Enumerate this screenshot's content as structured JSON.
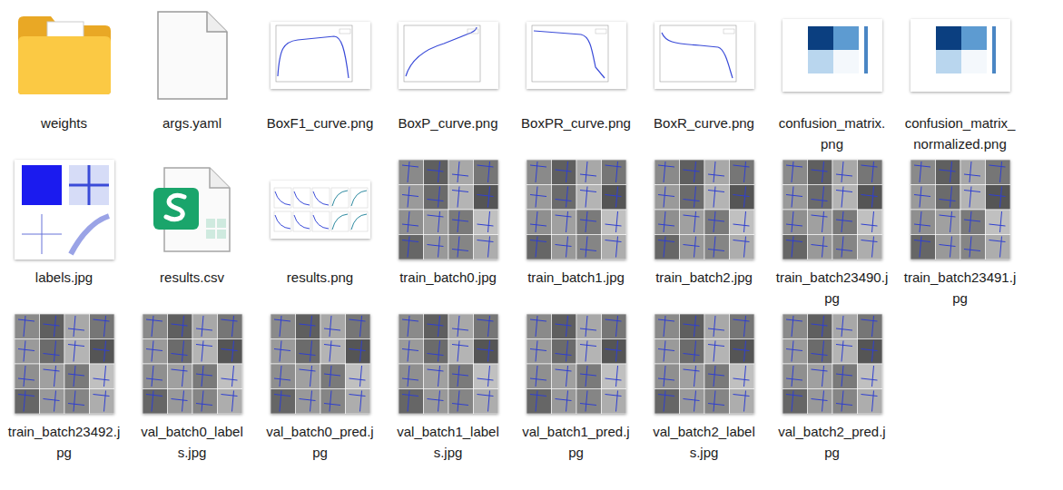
{
  "items": [
    {
      "name": "weights",
      "kind": "folder"
    },
    {
      "name": "args.yaml",
      "kind": "file"
    },
    {
      "name": "BoxF1_curve.png",
      "kind": "curve"
    },
    {
      "name": "BoxP_curve.png",
      "kind": "curve"
    },
    {
      "name": "BoxPR_curve.png",
      "kind": "curve"
    },
    {
      "name": "BoxR_curve.png",
      "kind": "curve"
    },
    {
      "name": "confusion_matrix.png",
      "kind": "matrix"
    },
    {
      "name": "confusion_matrix_normalized.png",
      "kind": "matrix"
    },
    {
      "name": "labels.jpg",
      "kind": "labels"
    },
    {
      "name": "results.csv",
      "kind": "sheet"
    },
    {
      "name": "results.png",
      "kind": "results"
    },
    {
      "name": "train_batch0.jpg",
      "kind": "batch"
    },
    {
      "name": "train_batch1.jpg",
      "kind": "batch"
    },
    {
      "name": "train_batch2.jpg",
      "kind": "batch"
    },
    {
      "name": "train_batch23490.jpg",
      "kind": "batch"
    },
    {
      "name": "train_batch23491.jpg",
      "kind": "batch"
    },
    {
      "name": "train_batch23492.jpg",
      "kind": "batch"
    },
    {
      "name": "val_batch0_labels.jpg",
      "kind": "batch"
    },
    {
      "name": "val_batch0_pred.jpg",
      "kind": "batch"
    },
    {
      "name": "val_batch1_labels.jpg",
      "kind": "batch"
    },
    {
      "name": "val_batch1_pred.jpg",
      "kind": "batch"
    },
    {
      "name": "val_batch2_labels.jpg",
      "kind": "batch"
    },
    {
      "name": "val_batch2_pred.jpg",
      "kind": "batch"
    }
  ]
}
